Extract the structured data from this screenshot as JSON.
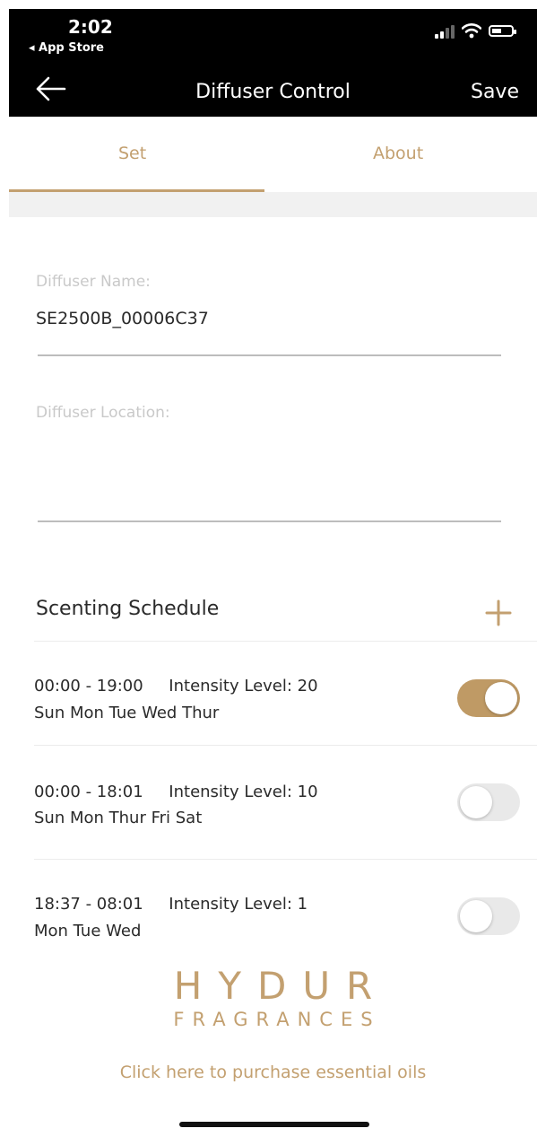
{
  "status_bar": {
    "time": "2:02",
    "back_app": "◂ App Store"
  },
  "nav": {
    "title": "Diffuser Control",
    "save_label": "Save"
  },
  "tabs": [
    {
      "label": "Set",
      "active": true
    },
    {
      "label": "About",
      "active": false
    }
  ],
  "form": {
    "name_label": "Diffuser Name:",
    "name_value": "SE2500B_00006C37",
    "location_label": "Diffuser Location:",
    "location_value": ""
  },
  "schedule": {
    "title": "Scenting Schedule",
    "rows": [
      {
        "line1": "00:00 - 19:00     Intensity Level: 20",
        "line2": "Sun Mon Tue Wed Thur",
        "enabled": true
      },
      {
        "line1": "00:00 - 18:01     Intensity Level: 10",
        "line2": "Sun Mon Thur Fri Sat",
        "enabled": false
      },
      {
        "line1": "18:37 - 08:01     Intensity Level: 1",
        "line2": "Mon Tue Wed",
        "enabled": false
      }
    ]
  },
  "brand": {
    "main": "HYDUR",
    "sub": "FRAGRANCES"
  },
  "purchase_link": "Click here to purchase essential oils",
  "colors": {
    "accent": "#c3a070",
    "toggle_on": "#bf9a65",
    "header_bg": "#000000"
  }
}
